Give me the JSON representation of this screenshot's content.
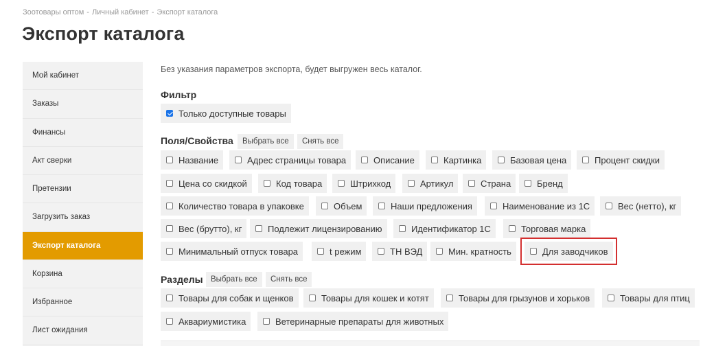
{
  "breadcrumb": {
    "items": [
      "Зоотовары оптом",
      "Личный кабинет",
      "Экспорт каталога"
    ],
    "separator": "-"
  },
  "page_title": "Экспорт каталога",
  "sidebar": {
    "items": [
      {
        "label": "Мой кабинет",
        "active": false
      },
      {
        "label": "Заказы",
        "active": false
      },
      {
        "label": "Финансы",
        "active": false
      },
      {
        "label": "Акт сверки",
        "active": false
      },
      {
        "label": "Претензии",
        "active": false
      },
      {
        "label": "Загрузить заказ",
        "active": false
      },
      {
        "label": "Экспорт каталога",
        "active": true
      },
      {
        "label": "Корзина",
        "active": false
      },
      {
        "label": "Избранное",
        "active": false
      },
      {
        "label": "Лист ожидания",
        "active": false
      }
    ]
  },
  "intro": "Без указания параметров экспорта, будет выгружен весь каталог.",
  "filter": {
    "title": "Фильтр",
    "option": {
      "label": "Только доступные товары",
      "checked": true
    }
  },
  "fields": {
    "title": "Поля/Свойства",
    "select_all": "Выбрать все",
    "clear_all": "Снять все",
    "options": [
      "Название",
      "Адрес страницы товара",
      "Описание",
      "Картинка",
      "Базовая цена",
      "Процент скидки",
      "Цена со скидкой",
      "Код товара",
      "Штрихкод",
      "Артикул",
      "Страна",
      "Бренд",
      "Количество товара в упаковке",
      "Объем",
      "Наши предложения",
      "Наименование из 1С",
      "Вес (нетто), кг",
      "Вес (брутто), кг",
      "Подлежит лицензированию",
      "Идентификатор 1С",
      "Торговая марка",
      "Минимальный отпуск товара",
      "t режим",
      "ТН ВЭД",
      "Мин. кратность",
      "Для заводчиков"
    ]
  },
  "sections": {
    "title": "Разделы",
    "select_all": "Выбрать все",
    "clear_all": "Снять все",
    "options": [
      "Товары для собак и щенков",
      "Товары для кошек и котят",
      "Товары для грызунов и хорьков",
      "Товары для птиц",
      "Аквариумистика",
      "Ветеринарные препараты для животных"
    ]
  },
  "colors": {
    "accent": "#e39b00",
    "highlight": "#d32f2f",
    "checkbox_checked": "#1a73e8"
  }
}
